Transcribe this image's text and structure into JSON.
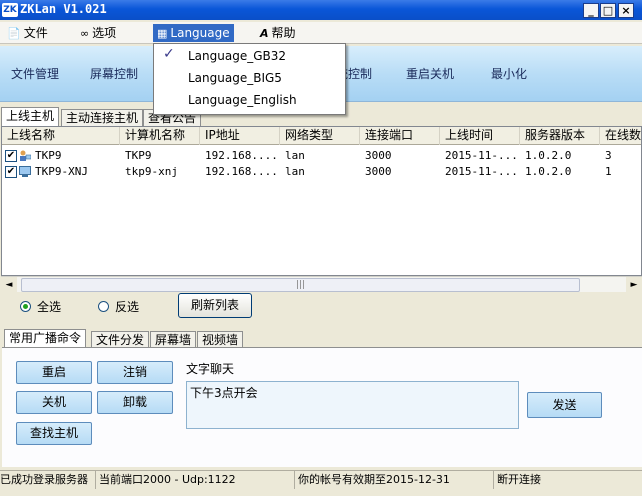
{
  "window": {
    "title": "ZKLan V1.021",
    "logo_text": "ZK",
    "controls": {
      "minimize": "_",
      "maximize": "□",
      "close": "×"
    }
  },
  "menubar": {
    "items": [
      {
        "label": "文件",
        "icon": "document-icon"
      },
      {
        "label": "选项",
        "icon": "glasses-icon"
      },
      {
        "label": "Language",
        "icon": "language-icon"
      },
      {
        "label": "帮助",
        "icon": "font-help-icon"
      }
    ]
  },
  "language_menu": {
    "items": [
      "Language_GB32",
      "Language_BIG5",
      "Language_English"
    ],
    "checked_index": 0,
    "check_glyph": "✓"
  },
  "toolbar": {
    "buttons": [
      "文件管理",
      "屏幕控制",
      "统控制",
      "重启关机",
      "最小化"
    ]
  },
  "top_tabs": [
    "上线主机",
    "主动连接主机",
    "查看公告"
  ],
  "grid": {
    "columns": [
      "上线名称",
      "计算机名称",
      "IP地址",
      "网络类型",
      "连接端口",
      "上线时间",
      "服务器版本",
      "在线数"
    ],
    "rows": [
      {
        "checked": true,
        "name": "TKP9",
        "computer": "TKP9",
        "ip": "192.168....",
        "net": "lan",
        "port": "3000",
        "time": "2015-11-...",
        "version": "1.0.2.0",
        "online": "3"
      },
      {
        "checked": true,
        "name": "TKP9-XNJ",
        "computer": "tkp9-xnj",
        "ip": "192.168....",
        "net": "lan",
        "port": "3000",
        "time": "2015-11-...",
        "version": "1.0.2.0",
        "online": "1"
      }
    ]
  },
  "scrollbar": {
    "left": "◄",
    "right": "►",
    "grip": "|||"
  },
  "selection": {
    "select_all": "全选",
    "invert": "反选",
    "refresh_button": "刷新列表",
    "selected": "select_all"
  },
  "bottom_tabs": [
    "常用广播命令",
    "文件分发",
    "屏幕墙",
    "视频墙"
  ],
  "commands": {
    "restart": "重启",
    "logout": "注销",
    "shutdown": "关机",
    "uninstall": "卸载",
    "find_host": "查找主机"
  },
  "chat": {
    "label": "文字聊天",
    "message": "下午3点开会",
    "send_button": "发送"
  },
  "status": {
    "login": "已成功登录服务器",
    "port": "当前端口2000 - Udp:1122",
    "expiry": "你的帐号有效期至2015-12-31",
    "connection": "断开连接"
  },
  "colors": {
    "title_bar": "#0a56d8",
    "toolbar": "#b9ddf6",
    "menu_highlight": "#316ac5",
    "blue_button": "#b6dbf5"
  }
}
